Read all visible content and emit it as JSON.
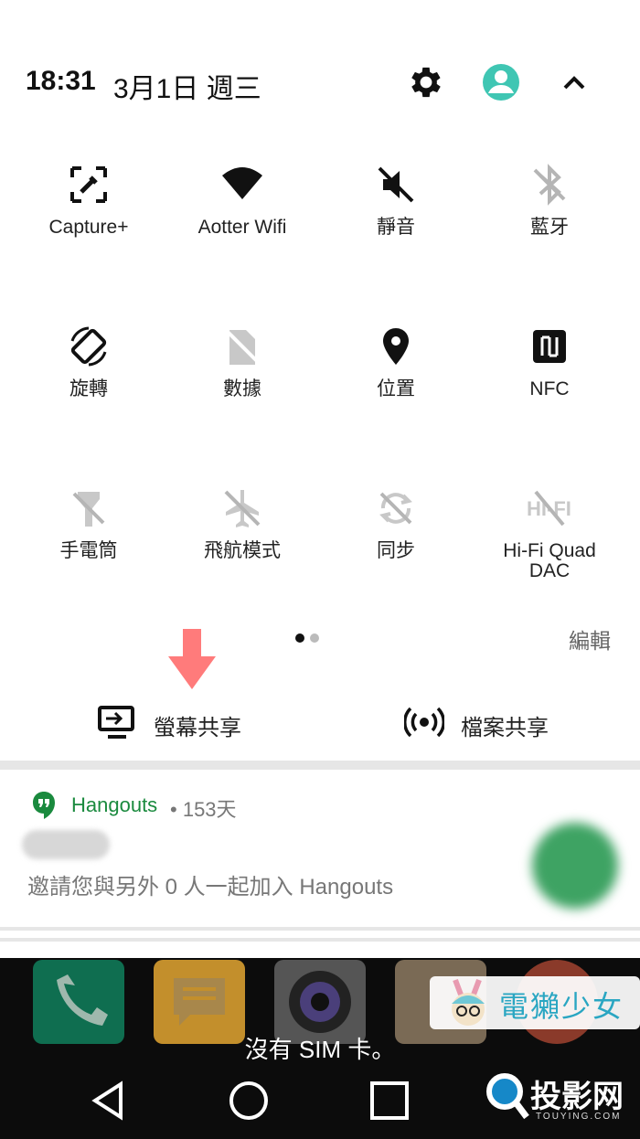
{
  "header": {
    "time": "18:31",
    "date": "3月1日 週三",
    "icons": [
      "gear-icon",
      "user-avatar-icon",
      "chevron-up-icon"
    ],
    "avatar_color": "#3fc6b3"
  },
  "quick_settings": {
    "tiles": [
      {
        "label": "Capture+",
        "icon": "capture-plus-icon",
        "active": true
      },
      {
        "label": "Aotter Wifi",
        "icon": "wifi-icon",
        "active": true
      },
      {
        "label": "靜音",
        "icon": "mute-icon",
        "active": true
      },
      {
        "label": "藍牙",
        "icon": "bluetooth-off-icon",
        "active": false
      },
      {
        "label": "旋轉",
        "icon": "rotate-icon",
        "active": true
      },
      {
        "label": "數據",
        "icon": "mobile-data-off-icon",
        "active": false
      },
      {
        "label": "位置",
        "icon": "location-icon",
        "active": true
      },
      {
        "label": "NFC",
        "icon": "nfc-icon",
        "active": true
      },
      {
        "label": "手電筒",
        "icon": "flashlight-off-icon",
        "active": false
      },
      {
        "label": "飛航模式",
        "icon": "airplane-off-icon",
        "active": false
      },
      {
        "label": "同步",
        "icon": "sync-off-icon",
        "active": false
      },
      {
        "label": "Hi-Fi Quad DAC",
        "icon": "hifi-off-icon",
        "active": false
      }
    ],
    "page_count": 2,
    "current_page": 1,
    "edit_label": "編輯"
  },
  "share": {
    "screen_share_label": "螢幕共享",
    "file_share_label": "檔案共享",
    "highlight_color": "#ff7b7b"
  },
  "notification": {
    "app_name": "Hangouts",
    "separator": "•",
    "time": "153天",
    "message": "邀請您與另外 0 人一起加入 Hangouts",
    "accent_color": "#1a8a3e"
  },
  "home": {
    "no_sim_text": "沒有 SIM 卡。",
    "nav_buttons": [
      "back-icon",
      "home-icon",
      "recents-icon"
    ]
  },
  "watermarks": {
    "badge_text": "電獺少女",
    "site_text": "投影网",
    "site_sub": "TOUYING.COM"
  }
}
